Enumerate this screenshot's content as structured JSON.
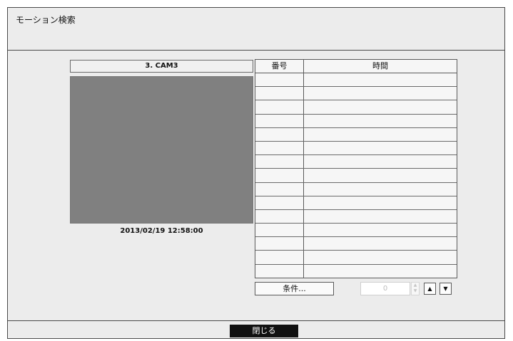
{
  "window": {
    "title": "モーション検索"
  },
  "camera": {
    "name": "3. CAM3",
    "timestamp": "2013/02/19  12:58:00"
  },
  "results": {
    "columns": {
      "number": "番号",
      "time": "時間"
    },
    "rows": [
      {
        "number": "",
        "time": ""
      },
      {
        "number": "",
        "time": ""
      },
      {
        "number": "",
        "time": ""
      },
      {
        "number": "",
        "time": ""
      },
      {
        "number": "",
        "time": ""
      },
      {
        "number": "",
        "time": ""
      },
      {
        "number": "",
        "time": ""
      },
      {
        "number": "",
        "time": ""
      },
      {
        "number": "",
        "time": ""
      },
      {
        "number": "",
        "time": ""
      },
      {
        "number": "",
        "time": ""
      },
      {
        "number": "",
        "time": ""
      },
      {
        "number": "",
        "time": ""
      },
      {
        "number": "",
        "time": ""
      },
      {
        "number": "",
        "time": ""
      }
    ]
  },
  "controls": {
    "condition_label": "条件...",
    "spin_value": "0",
    "spin_up_icon": "spin-up-icon",
    "spin_down_icon": "spin-down-icon",
    "page_up_icon": "triangle-up-icon",
    "page_down_icon": "triangle-down-icon"
  },
  "footer": {
    "close_label": "閉じる"
  }
}
